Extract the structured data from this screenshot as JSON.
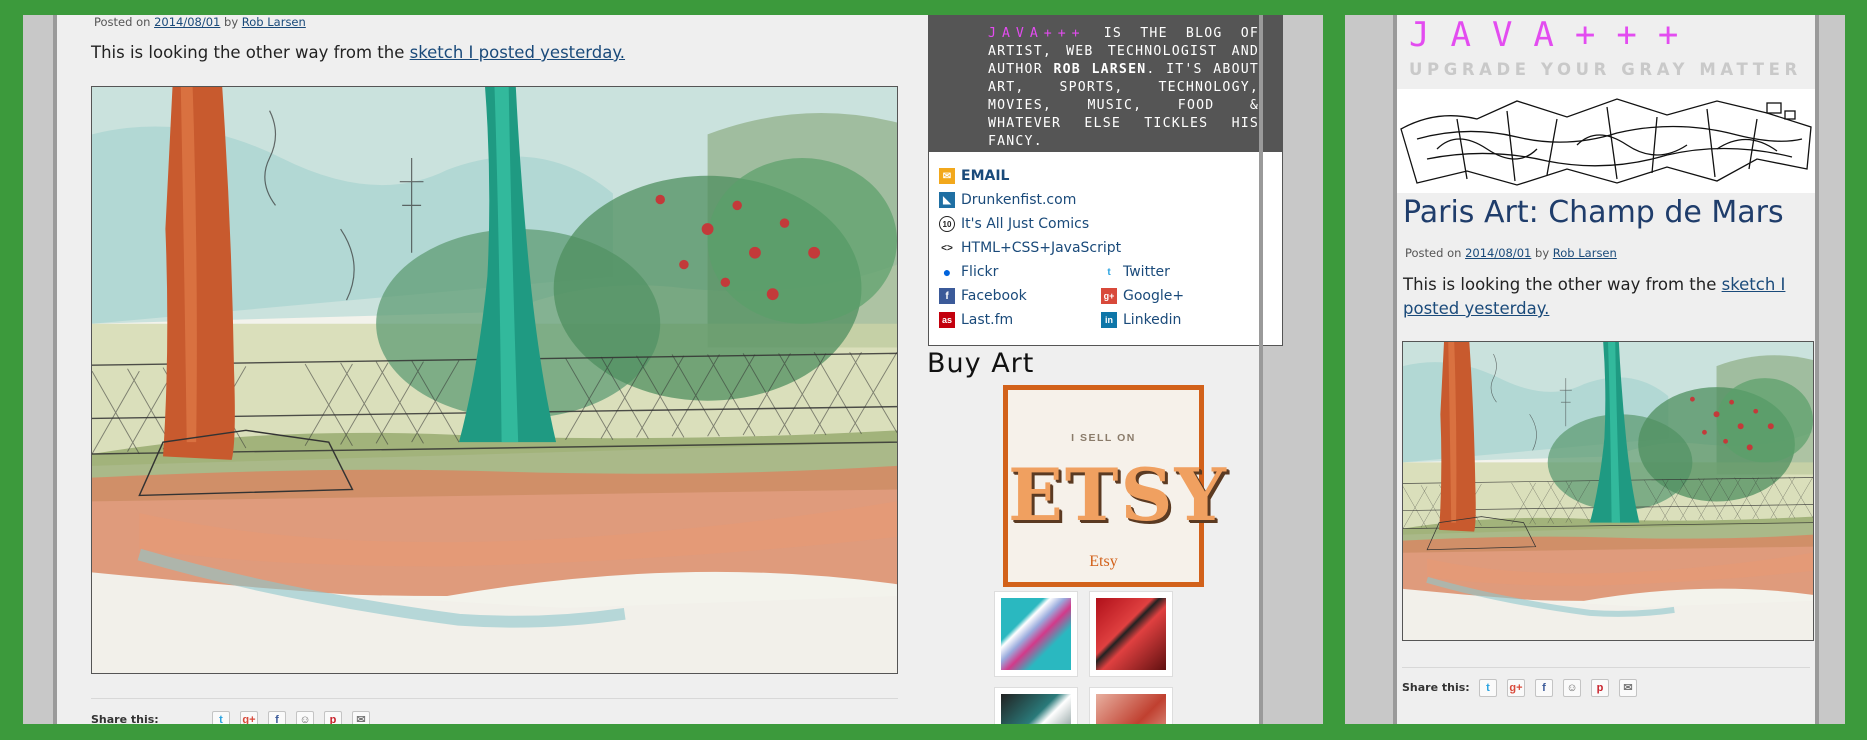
{
  "post": {
    "meta_prefix": "Posted on",
    "date": "2014/08/01",
    "meta_by": "by",
    "author": "Rob Larsen",
    "lead_text": "This is looking the other way from the",
    "lead_link": "sketch I posted yesterday.",
    "lead_link_line1": "sketch I",
    "lead_link_line2": "posted yesterday."
  },
  "share": {
    "label": "Share this:",
    "icons": [
      "twitter-icon",
      "google-plus-icon",
      "facebook-icon",
      "reddit-icon",
      "pinterest-icon",
      "email-icon"
    ],
    "glyphs": [
      "t",
      "g+",
      "f",
      "☺",
      "p",
      "✉"
    ]
  },
  "sidebar": {
    "about_brand": "JAVA+++",
    "about_text_1": "is the blog of artist, web technologist and author",
    "about_author": "Rob Larsen",
    "about_text_2": ". It's about art, sports, technology, movies, music, food & whatever else tickles his fancy.",
    "links": {
      "email": "EMAIL",
      "drunkenfist": "Drunkenfist.com",
      "comics": "It's All Just Comics",
      "html": "HTML+CSS+JavaScript",
      "flickr": "Flickr",
      "twitter": "Twitter",
      "facebook": "Facebook",
      "googleplus": "Google+",
      "lastfm": "Last.fm",
      "linkedin": "Linkedin"
    },
    "buy_art": "Buy Art",
    "etsy": {
      "sell": "I SELL ON",
      "big": "ETSY",
      "small": "Etsy"
    }
  },
  "mobile": {
    "logo": "JAVA+++",
    "tagline": "UPGRADE YOUR GRAY MATTER",
    "title": "Paris Art: Champ de Mars"
  },
  "colors": {
    "background_green": "#3c9a3c",
    "brand_magenta": "#e34cf0",
    "etsy_orange": "#d2611a",
    "link_blue": "#1a4a7a"
  }
}
